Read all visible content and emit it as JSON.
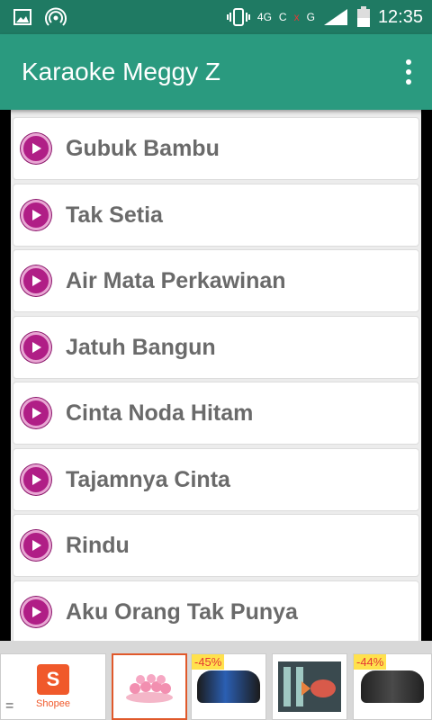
{
  "status": {
    "network": "4G",
    "carrier_c": "C",
    "carrier_x": "x",
    "signal_g": "G",
    "time": "12:35"
  },
  "app_bar": {
    "title": "Karaoke Meggy Z",
    "menu_icon": "overflow-menu-icon"
  },
  "songs": [
    "Gubuk Bambu",
    "Tak Setia",
    "Air Mata Perkawinan",
    "Jatuh Bangun",
    "Cinta Noda Hitam",
    "Tajamnya Cinta",
    "Rindu",
    "Aku Orang Tak Punya"
  ],
  "ads": {
    "brand": "Shopee",
    "brand_letter": "S",
    "menu": "=",
    "discount_1": "-45%",
    "discount_2": "-44%",
    "accent": "#f0592b"
  },
  "colors": {
    "app_bar": "#2a9a7f",
    "status_bar": "#1f7a63",
    "play_button": "#b01e86"
  }
}
